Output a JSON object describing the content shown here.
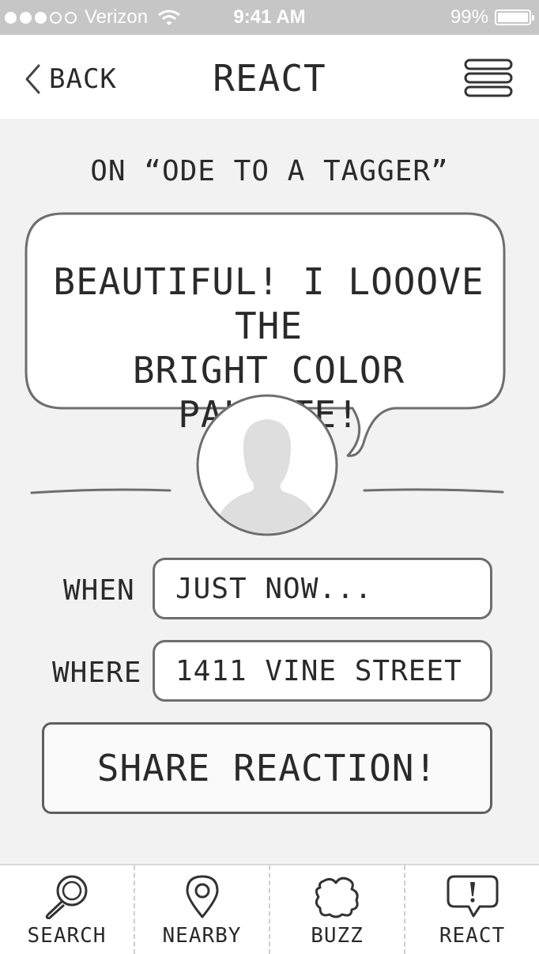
{
  "status_bar": {
    "carrier": "Verizon",
    "time": "9:41 AM",
    "battery": "99%",
    "battery_level": 0.99
  },
  "nav": {
    "back_label": "BACK",
    "title": "REACT"
  },
  "subtitle": "ON “ODE TO A TAGGER”",
  "quote": {
    "line1": "BEAUTIFUL! I LOOOVE THE",
    "line2": "BRIGHT COLOR PALETTE!"
  },
  "form": {
    "when_label": "WHEN",
    "when_value": "JUST NOW...",
    "where_label": "WHERE",
    "where_value": "1411 VINE STREET"
  },
  "share_button": "SHARE REACTION!",
  "tabs": [
    {
      "label": "SEARCH",
      "icon": "search-icon"
    },
    {
      "label": "NEARBY",
      "icon": "location-pin-icon"
    },
    {
      "label": "BUZZ",
      "icon": "splat-icon"
    },
    {
      "label": "REACT",
      "icon": "exclamation-speech-icon"
    }
  ],
  "colors": {
    "status_bar": "#c6c6c6",
    "background": "#f2f2f2",
    "outline": "#6e6e6e"
  }
}
